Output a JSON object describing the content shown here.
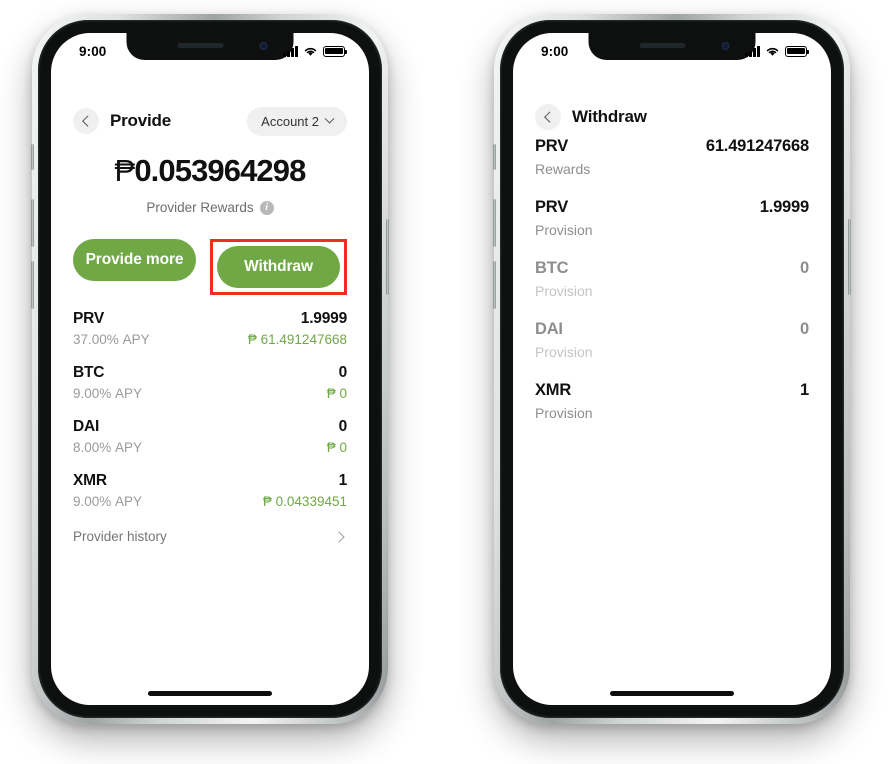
{
  "currency_symbol": "₱",
  "colors": {
    "accent_green": "#6fa845",
    "highlight_red": "#ee2e24",
    "muted_gray": "#9a9a9a",
    "dim_gray": "#c2c4c6"
  },
  "phones": [
    {
      "id": "provide-screen",
      "status_bar": {
        "time": "9:00",
        "cellular": "signal-bars-icon",
        "wifi": "wifi-icon",
        "battery": "battery-full-icon"
      },
      "nav": {
        "back": "chevron-left-icon",
        "title": "Provide",
        "account_chip": {
          "label": "Account 2",
          "caret": "chevron-down-icon"
        }
      },
      "balance": {
        "symbol": "₱",
        "amount": "0.053964298"
      },
      "rewards_label": "Provider Rewards",
      "info_icon": "i",
      "buttons": {
        "provide_more": "Provide more",
        "withdraw": "Withdraw"
      },
      "highlighted_button": "Withdraw",
      "rows": [
        {
          "symbol": "PRV",
          "amount": "1.9999",
          "apy": "37.00%",
          "apy_suffix": "APY",
          "fiat": "₱ 61.491247668"
        },
        {
          "symbol": "BTC",
          "amount": "0",
          "apy": "9.00%",
          "apy_suffix": "APY",
          "fiat": "₱ 0"
        },
        {
          "symbol": "DAI",
          "amount": "0",
          "apy": "8.00%",
          "apy_suffix": "APY",
          "fiat": "₱ 0"
        },
        {
          "symbol": "XMR",
          "amount": "1",
          "apy": "9.00%",
          "apy_suffix": "APY",
          "fiat": "₱ 0.04339451"
        }
      ],
      "history": {
        "label": "Provider history",
        "chevron": "chevron-right-icon"
      }
    },
    {
      "id": "withdraw-screen",
      "status_bar": {
        "time": "9:00",
        "cellular": "signal-bars-icon",
        "wifi": "wifi-icon",
        "battery": "battery-full-icon"
      },
      "nav": {
        "back": "chevron-left-icon",
        "title": "Withdraw"
      },
      "rows": [
        {
          "symbol": "PRV",
          "amount": "61.491247668",
          "type": "Rewards",
          "dim": false
        },
        {
          "symbol": "PRV",
          "amount": "1.9999",
          "type": "Provision",
          "dim": false
        },
        {
          "symbol": "BTC",
          "amount": "0",
          "type": "Provision",
          "dim": true
        },
        {
          "symbol": "DAI",
          "amount": "0",
          "type": "Provision",
          "dim": true
        },
        {
          "symbol": "XMR",
          "amount": "1",
          "type": "Provision",
          "dim": false
        }
      ]
    }
  ]
}
